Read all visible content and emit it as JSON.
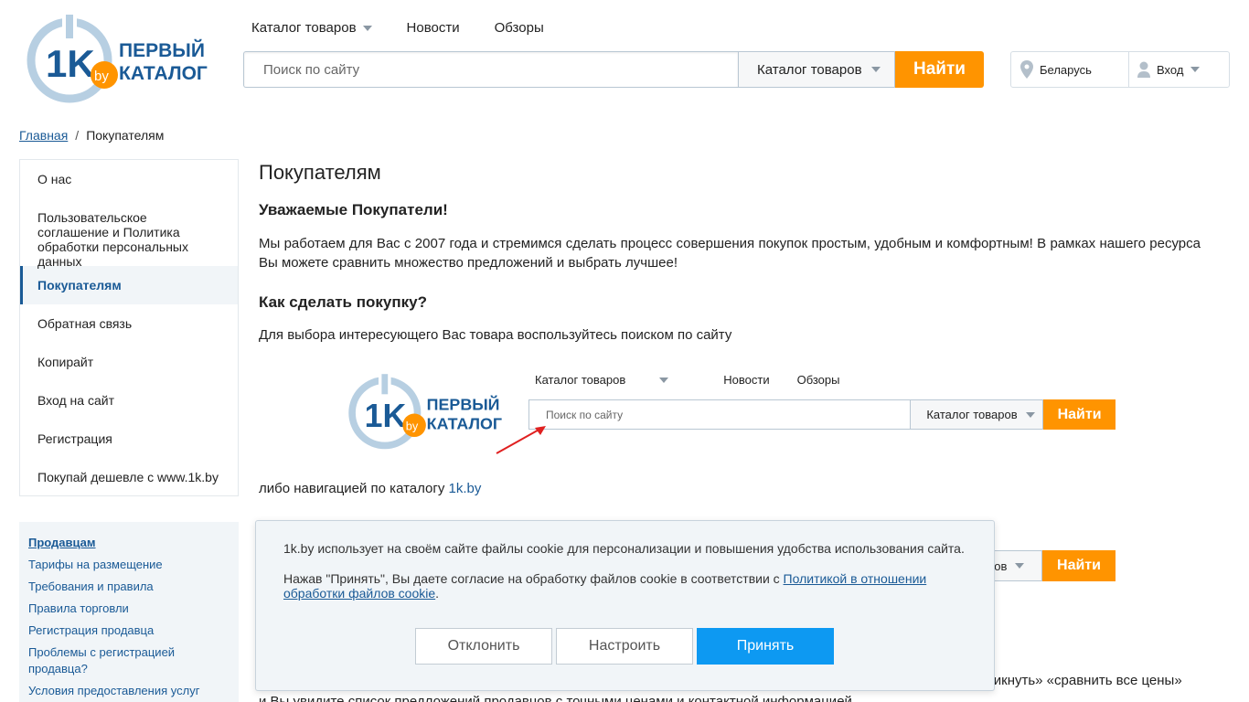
{
  "logo": {
    "number": "1K",
    "badge": "by",
    "line1": "ПЕРВЫЙ",
    "line2": "КАТАЛОГ"
  },
  "topnav": {
    "catalog": "Каталог товаров",
    "news": "Новости",
    "reviews": "Обзоры"
  },
  "search": {
    "placeholder": "Поиск по сайту",
    "category": "Каталог товаров",
    "button": "Найти"
  },
  "user": {
    "region": "Беларусь",
    "login": "Вход"
  },
  "breadcrumb": {
    "home": "Главная",
    "sep": "/",
    "current": "Покупателям"
  },
  "sidebar": {
    "items": [
      {
        "label": "О нас"
      },
      {
        "label": "Пользовательское соглашение и Политика обработки персональных данных"
      },
      {
        "label": "Покупателям"
      },
      {
        "label": "Обратная связь"
      },
      {
        "label": "Копирайт"
      },
      {
        "label": "Вход на сайт"
      },
      {
        "label": "Регистрация"
      },
      {
        "label": "Покупай дешевле с www.1k.by"
      }
    ],
    "active_index": 2
  },
  "sellers": {
    "title": "Продавцам",
    "links": [
      "Тарифы на размещение",
      "Требования и правила",
      "Правила торговли",
      "Регистрация продавца",
      "Проблемы с регистрацией продавца?",
      "Условия предоставления услуг"
    ]
  },
  "content": {
    "title": "Покупателям",
    "greeting": "Уважаемые Покупатели!",
    "intro": "Мы работаем для Вас с 2007 года и стремимся сделать процесс совершения покупок простым, удобным и комфортным! В рамках нашего ресурса Вы можете сравнить множество предложений и выбрать лучшее!",
    "how_title": "Как сделать покупку?",
    "how_text": "Для выбора интересующего Вас товара воспользуйтесь поиском по сайту",
    "nav_text_prefix": "либо навигацией по каталогу ",
    "nav_link": "1k.by",
    "tail_right": "ликнуть» «сравнить все цены»",
    "tail_line": "и Вы увидите список предложений продавцов с точными ценами и контактной информацией"
  },
  "example": {
    "catalog": "Каталог товаров",
    "news": "Новости",
    "reviews": "Обзоры",
    "placeholder": "Поиск по сайту",
    "category": "Каталог товаров",
    "button": "Найти",
    "category_partial": "ров"
  },
  "cookie": {
    "text1": "1k.by использует на своём сайте файлы cookie для персонализации и повышения удобства использования сайта.",
    "text2_prefix": "Нажав \"Принять\", Вы даете согласие на обработку файлов cookie в соответствии с ",
    "text2_link": "Политикой в отношении обработки файлов cookie",
    "text2_suffix": ".",
    "decline": "Отклонить",
    "configure": "Настроить",
    "accept": "Принять"
  },
  "colors": {
    "brand_blue": "#1a5a96",
    "accent_orange": "#ff9400",
    "accept_blue": "#0d99f2"
  }
}
